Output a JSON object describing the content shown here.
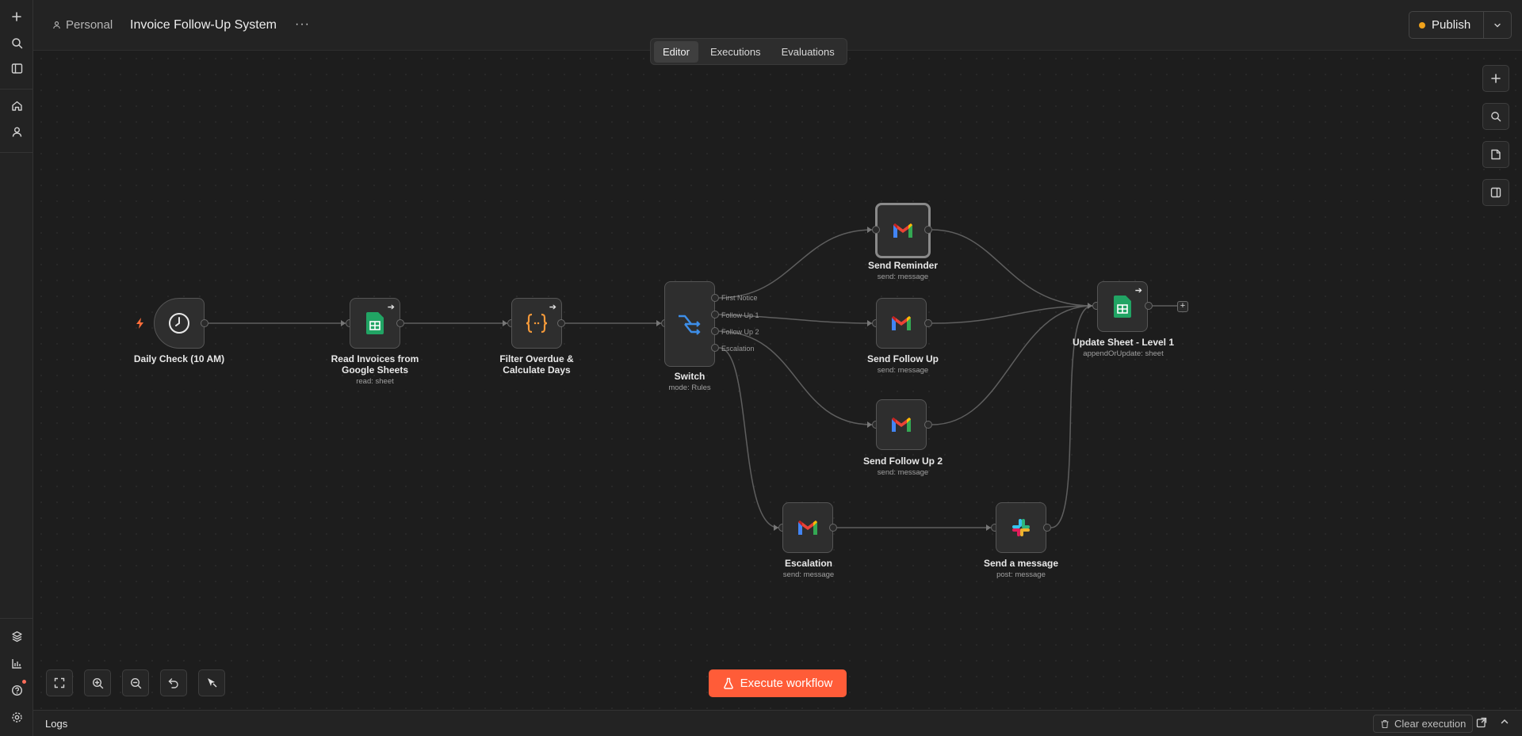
{
  "header": {
    "workspace": "Personal",
    "workflow_title": "Invoice Follow-Up System",
    "more": "···",
    "tabs": [
      {
        "label": "Editor",
        "active": true
      },
      {
        "label": "Executions",
        "active": false
      },
      {
        "label": "Evaluations",
        "active": false
      }
    ],
    "publish_label": "Publish",
    "publish_status_color": "#f0a21b"
  },
  "nodes": {
    "trigger": {
      "label": "Daily Check (10 AM)",
      "icon": "clock-icon"
    },
    "read_sheets": {
      "label_line1": "Read Invoices from",
      "label_line2": "Google Sheets",
      "sub": "read: sheet",
      "icon": "google-sheets-icon"
    },
    "filter": {
      "label_line1": "Filter Overdue &",
      "label_line2": "Calculate Days",
      "icon": "code-braces-icon"
    },
    "switch": {
      "label": "Switch",
      "sub": "mode: Rules",
      "icon": "switch-icon",
      "outputs": [
        "First Notice",
        "Follow Up 1",
        "Follow Up 2",
        "Escalation"
      ]
    },
    "send_reminder": {
      "label": "Send Reminder",
      "sub": "send: message",
      "icon": "gmail-icon"
    },
    "send_follow_up": {
      "label": "Send Follow Up",
      "sub": "send: message",
      "icon": "gmail-icon"
    },
    "send_follow_up_2": {
      "label": "Send Follow Up 2",
      "sub": "send: message",
      "icon": "gmail-icon"
    },
    "escalation": {
      "label": "Escalation",
      "sub": "send: message",
      "icon": "gmail-icon"
    },
    "slack": {
      "label": "Send a message",
      "sub": "post: message",
      "icon": "slack-icon"
    },
    "update_sheet": {
      "label": "Update Sheet - Level 1",
      "sub": "appendOrUpdate: sheet",
      "icon": "google-sheets-icon"
    }
  },
  "execute_label": "Execute workflow",
  "logs": {
    "label": "Logs",
    "clear_label": "Clear execution"
  },
  "colors": {
    "accent": "#ff5c38",
    "canvas": "#1d1d1d",
    "sheets_green": "#21a464",
    "code_orange": "#f59a3a",
    "switch_blue": "#3d8ee8"
  }
}
